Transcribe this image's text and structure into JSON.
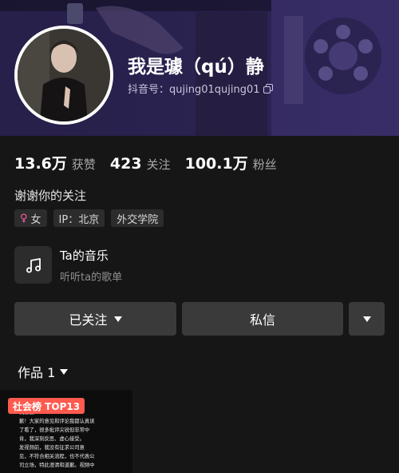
{
  "profile": {
    "name": "我是璩（qú）静",
    "douyin_id": "抖音号：qujing01qujing01",
    "bio": "谢谢你的关注"
  },
  "stats": [
    {
      "num": "13.6万",
      "label": "获赞"
    },
    {
      "num": "423",
      "label": "关注"
    },
    {
      "num": "100.1万",
      "label": "粉丝"
    }
  ],
  "tags": {
    "gender_icon": "female-icon",
    "gender": "女",
    "ip": "IP：北京",
    "school": "外交学院"
  },
  "music": {
    "icon": "music-note-icon",
    "title": "Ta的音乐",
    "subtitle": "听听ta的歌单"
  },
  "actions": {
    "follow_label": "已关注",
    "message_label": "私信"
  },
  "works": {
    "tab_label": "作品 1",
    "thumb_badge": "社会榜 TOP13",
    "thumb_text": "  频引起了\n  减意道\n歉！大家的意见和评论我都认真读\n了看了，很多批评尖锐但非常中\n肯，我深刻反思、虚心接受。\n  发视频前，我没有征求公司意\n见，不符合相关流程，也不代表公\n司立场，特此澄清和道歉。视频中"
  },
  "colors": {
    "banner": "#2f2658",
    "page_bg": "#161616",
    "button_bg": "#3a3a3a",
    "badge": "#ff5a4e",
    "female": "#ff5aa5"
  }
}
